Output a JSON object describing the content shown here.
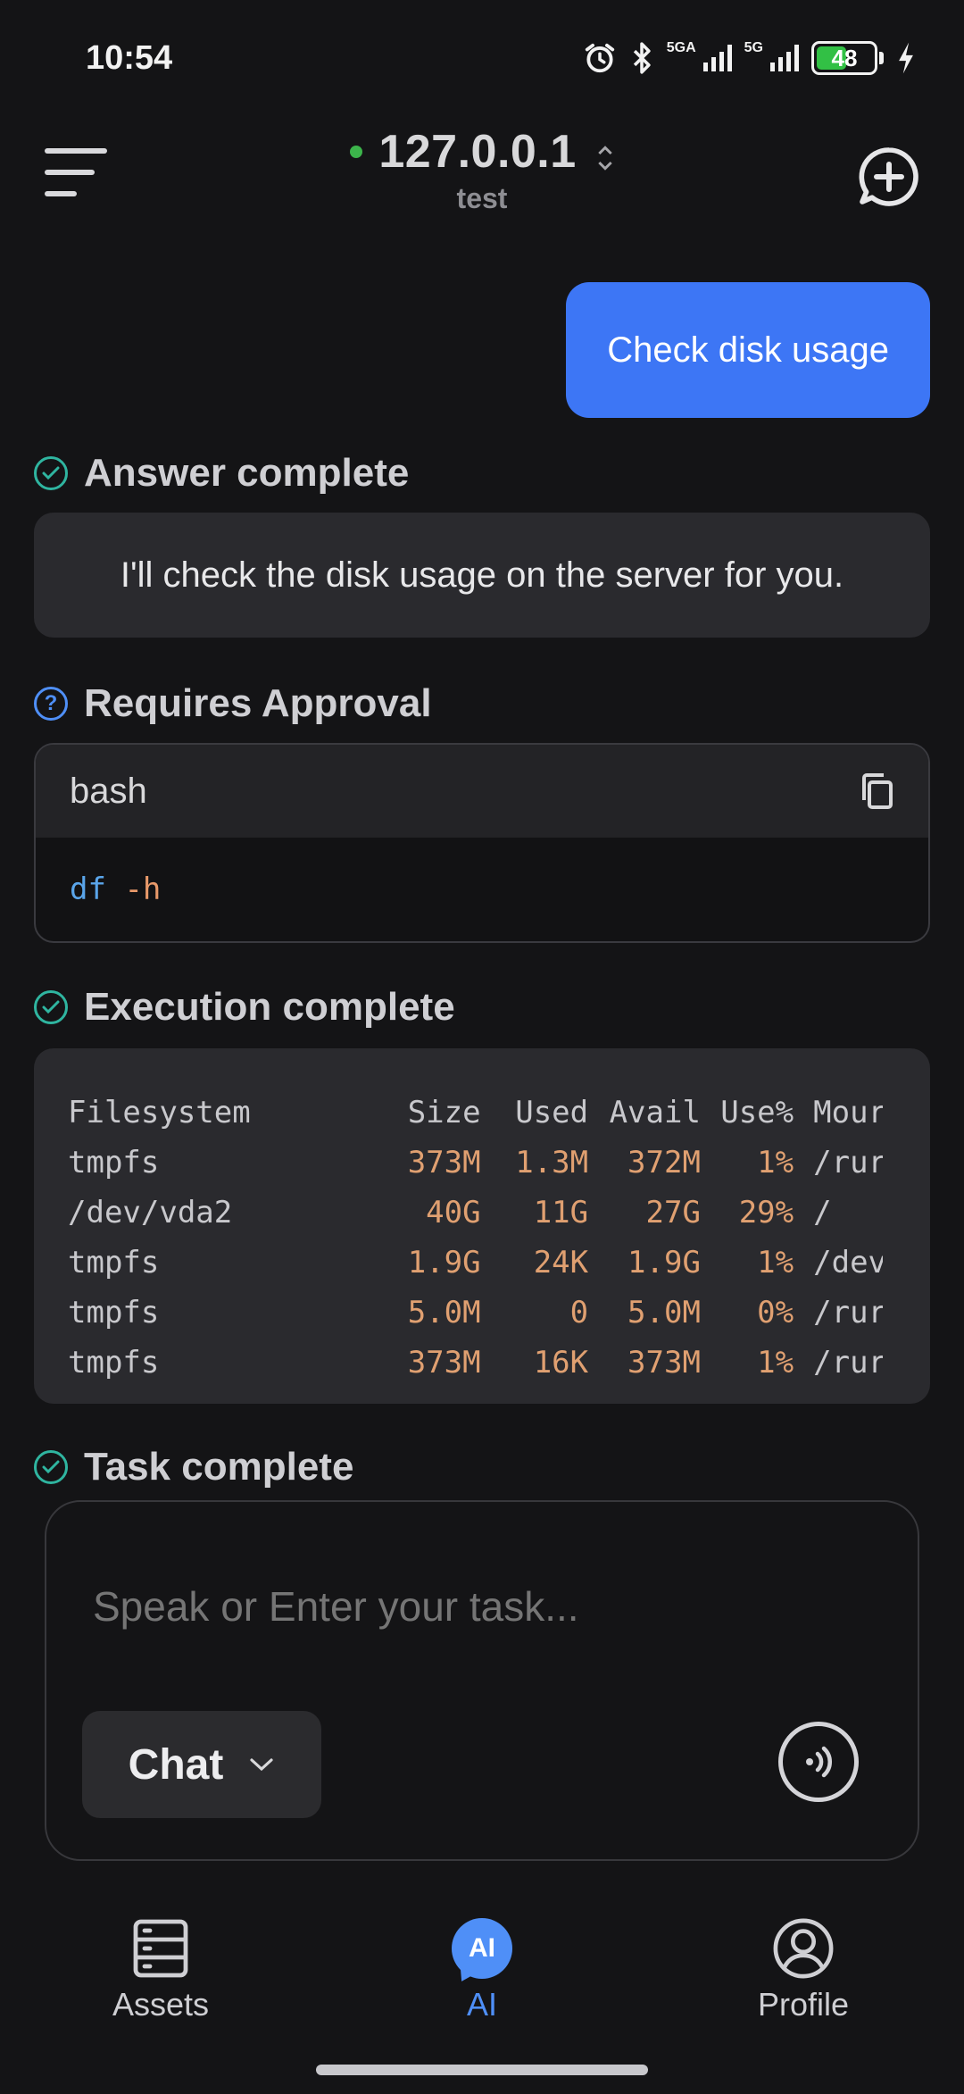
{
  "status_bar": {
    "time": "10:54",
    "net1": "5GA",
    "net2": "5G",
    "battery_level": "48",
    "battery_color": "#32c045"
  },
  "header": {
    "host": "127.0.0.1",
    "session": "test",
    "status_color": "#3cb44b"
  },
  "conversation": {
    "user_message": "Check disk usage",
    "answer_status": "Answer complete",
    "answer_text": "I'll check the disk usage on the server for you.",
    "approval_status": "Requires Approval",
    "code": {
      "language": "bash",
      "command": "df",
      "args": "-h"
    },
    "execution_status": "Execution complete",
    "output": {
      "headers": [
        "Filesystem",
        "Size",
        "Used",
        "Avail",
        "Use%",
        "Mour"
      ],
      "rows": [
        [
          "tmpfs",
          "373M",
          "1.3M",
          "372M",
          "1%",
          "/rur"
        ],
        [
          "/dev/vda2",
          "40G",
          "11G",
          "27G",
          "29%",
          "/"
        ],
        [
          "tmpfs",
          "1.9G",
          "24K",
          "1.9G",
          "1%",
          "/dev"
        ],
        [
          "tmpfs",
          "5.0M",
          "0",
          "5.0M",
          "0%",
          "/rur"
        ],
        [
          "tmpfs",
          "373M",
          "16K",
          "373M",
          "1%",
          "/rur"
        ]
      ]
    },
    "task_status": "Task complete"
  },
  "composer": {
    "placeholder": "Speak or Enter your task...",
    "mode": "Chat"
  },
  "bottom_nav": {
    "tabs": [
      {
        "label": "Assets",
        "icon": "server-stack-icon",
        "active": false
      },
      {
        "label": "AI",
        "icon": "ai-chat-icon",
        "active": true
      },
      {
        "label": "Profile",
        "icon": "user-circle-icon",
        "active": false
      }
    ]
  },
  "colors": {
    "accent": "#3d76f5",
    "success": "#2fb5a0",
    "numeric_output": "#e0a071"
  }
}
